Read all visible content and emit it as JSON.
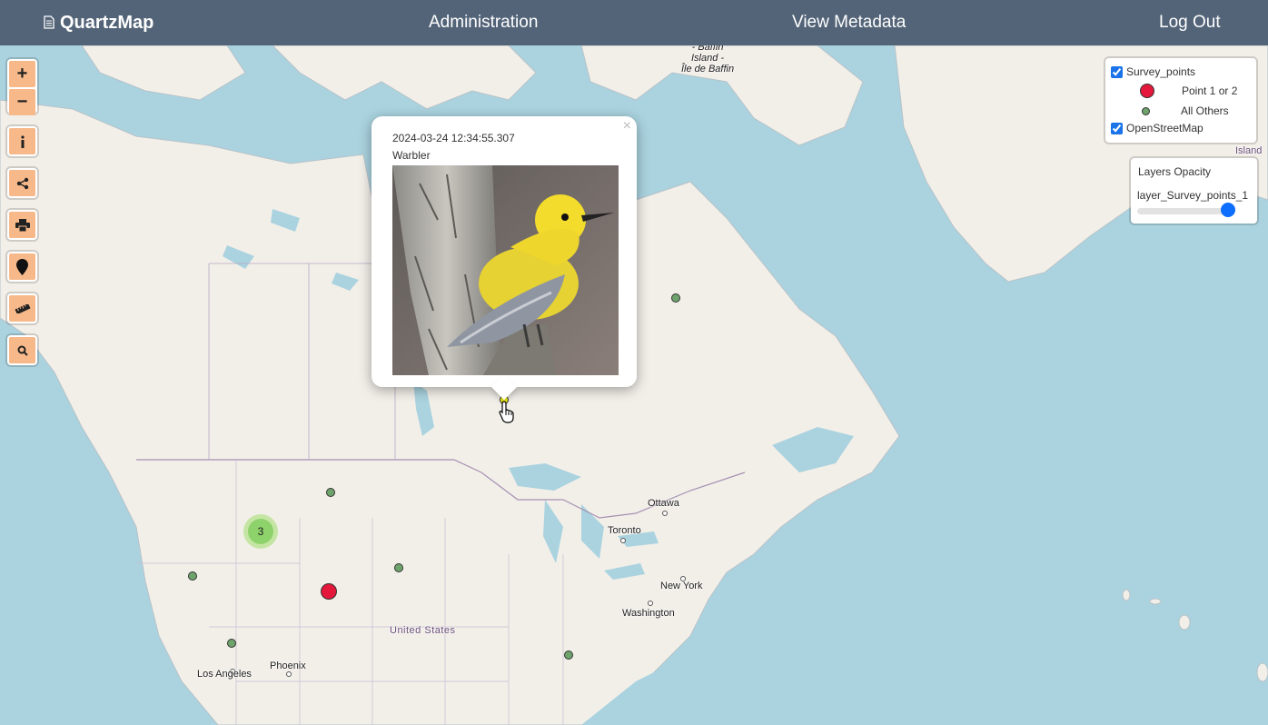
{
  "navbar": {
    "brand": "QuartzMap",
    "brand_icon": "document-icon",
    "links": [
      "Administration",
      "View Metadata",
      "Log Out"
    ]
  },
  "map_controls": {
    "zoom_in": "+",
    "zoom_out": "−",
    "tools": [
      "info-icon",
      "share-icon",
      "print-icon",
      "location-pin-icon",
      "ruler-icon",
      "search-icon"
    ]
  },
  "places": {
    "baffin_island": [
      "- Baffin",
      "Island -",
      "Île de Baffin"
    ],
    "island_edge": "Island",
    "ottawa": "Ottawa",
    "toronto": "Toronto",
    "new_york": "New York",
    "washington": "Washington",
    "united_states": "United States",
    "phoenix": "Phoenix",
    "los_angeles": "Los Angeles"
  },
  "cluster": {
    "count": "3"
  },
  "popup": {
    "timestamp": "2024-03-24 12:34:55.307",
    "species": "Warbler",
    "close": "×"
  },
  "legend": {
    "layer_name": "Survey_points",
    "entry_1": "Point 1 or 2",
    "entry_2": "All Others",
    "base_layer": "OpenStreetMap",
    "colors": {
      "point_1_or_2": "#e3183a",
      "all_others": "#6ea36b",
      "selected": "#f2f21b"
    }
  },
  "opacity_panel": {
    "title": "Layers Opacity",
    "layer": "layer_Survey_points_1",
    "value": 1.0
  },
  "colors": {
    "navbar": "#536478",
    "button": "#f7b98a",
    "water": "#aad3df",
    "land": "#f2efe9"
  }
}
